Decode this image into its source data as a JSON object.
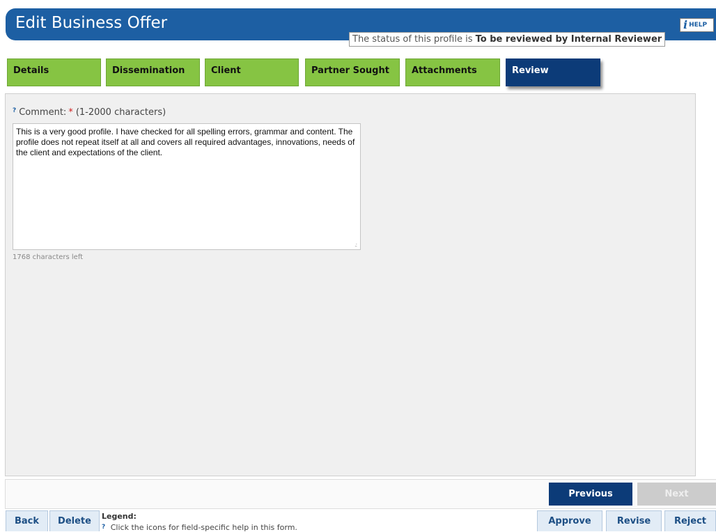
{
  "header": {
    "title": "Edit Business Offer",
    "help_label": "HELP",
    "help_icon_glyph": "i",
    "status_prefix": "The status of this profile is ",
    "status_value": "To be reviewed by Internal Reviewer"
  },
  "tabs": [
    {
      "label": "Details",
      "active": false
    },
    {
      "label": "Dissemination",
      "active": false
    },
    {
      "label": "Client",
      "active": false
    },
    {
      "label": "Partner Sought",
      "active": false
    },
    {
      "label": "Attachments",
      "active": false
    },
    {
      "label": "Review",
      "active": true
    }
  ],
  "review": {
    "help_glyph": "?",
    "comment_label": "Comment:",
    "required_marker": "*",
    "char_range": "(1-2000 characters)",
    "comment_value": "This is a very good profile. I have checked for all spelling errors, grammar and content. The profile does not repeat itself at all and covers all required advantages, innovations, needs of the client and expectations of the client.",
    "chars_left": "1768 characters left"
  },
  "navigation": {
    "previous_label": "Previous",
    "next_label": "Next"
  },
  "footer": {
    "back_label": "Back",
    "delete_label": "Delete",
    "legend_title": "Legend:",
    "legend_glyph": "?",
    "legend_text": "Click the icons for field-specific help in this form.",
    "approve_label": "Approve",
    "revise_label": "Revise",
    "reject_label": "Reject"
  },
  "colors": {
    "header_blue": "#1d5fa3",
    "tab_green": "#86c443",
    "tab_active": "#0c3b78",
    "required_red": "#d02020"
  }
}
